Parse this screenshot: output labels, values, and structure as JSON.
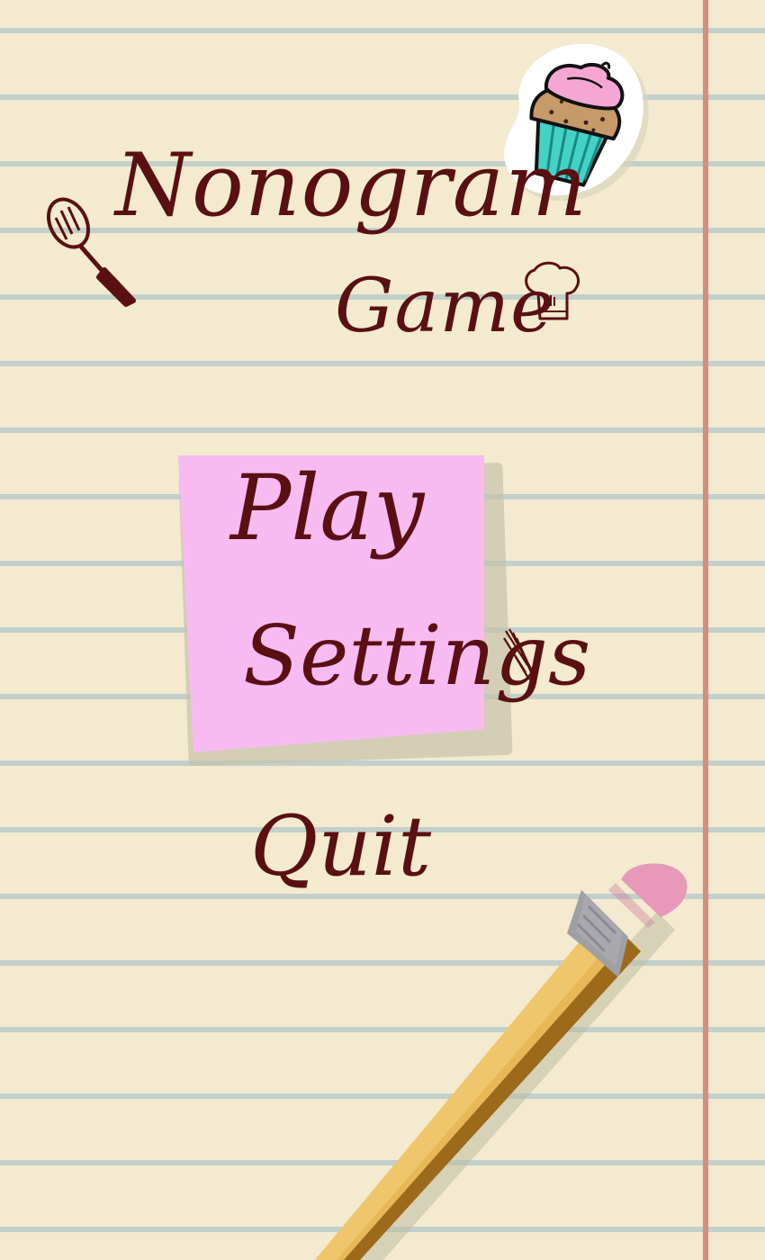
{
  "title": {
    "line1": "Nonogram",
    "line2": "Game"
  },
  "menu": {
    "play": "Play",
    "settings": "Settings",
    "quit": "Quit"
  },
  "decorations": {
    "cupcake": "cupcake-icon",
    "spatula": "spatula-icon",
    "chef_hat": "chef-hat-icon",
    "pencil": "pencil-icon",
    "sticky_note": "sticky-note"
  },
  "colors": {
    "paper": "#f3ead0",
    "ruled_line": "#c2cfcb",
    "margin_line": "#d88b80",
    "ink": "#5a0f12",
    "sticky_note": "#f7bbf2",
    "pencil_body": "#e8b858",
    "eraser": "#e898b8"
  }
}
